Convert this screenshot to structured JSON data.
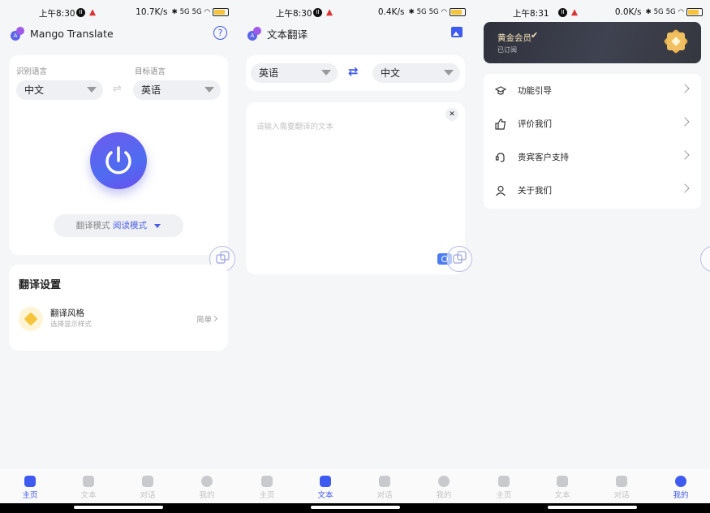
{
  "colors": {
    "accent": "#3e5af0",
    "gold": "#f5c43a",
    "vip_bg": "#3a3c48"
  },
  "screens": [
    {
      "status": {
        "time": "上午8:30",
        "rate": "10.7K/s",
        "badge_a": "II",
        "signal": "5G",
        "battery": "22"
      },
      "header": {
        "title": "Mango Translate",
        "help_icon": "?"
      },
      "translate": {
        "source_label": "识别语言",
        "source_value": "中文",
        "target_label": "目标语言",
        "target_value": "英语",
        "swap_icon": "⇌",
        "mode_label": "翻译模式",
        "mode_value": "阅读模式"
      },
      "settings": {
        "title": "翻译设置",
        "item_title": "翻译风格",
        "item_subtitle": "选择显示样式",
        "item_value": "简单"
      }
    },
    {
      "status": {
        "time": "上午8:30",
        "rate": "0.4K/s",
        "badge_a": "II",
        "signal": "5G",
        "battery": "22"
      },
      "header": {
        "title": "文本翻译"
      },
      "translate": {
        "source_value": "英语",
        "swap_icon": "⇄",
        "target_value": "中文"
      },
      "input": {
        "placeholder": "请输入需要翻译的文本",
        "clear_icon": "✕"
      }
    },
    {
      "status": {
        "time": "上午8:31",
        "rate": "0.0K/s",
        "badge_a": "II",
        "signal": "5G",
        "battery": "22"
      },
      "vip": {
        "title": "黄金会员",
        "status": "已订阅"
      },
      "menu": [
        {
          "label": "功能引导",
          "icon": "graduation-cap-icon"
        },
        {
          "label": "评价我们",
          "icon": "thumbs-up-icon"
        },
        {
          "label": "贵宾客户支持",
          "icon": "support-icon"
        },
        {
          "label": "关于我们",
          "icon": "person-icon"
        }
      ]
    }
  ],
  "tabs": [
    {
      "label": "主页",
      "icon": "home-icon"
    },
    {
      "label": "文本",
      "icon": "document-icon"
    },
    {
      "label": "对话",
      "icon": "conversation-icon"
    },
    {
      "label": "我的",
      "icon": "profile-icon"
    }
  ]
}
